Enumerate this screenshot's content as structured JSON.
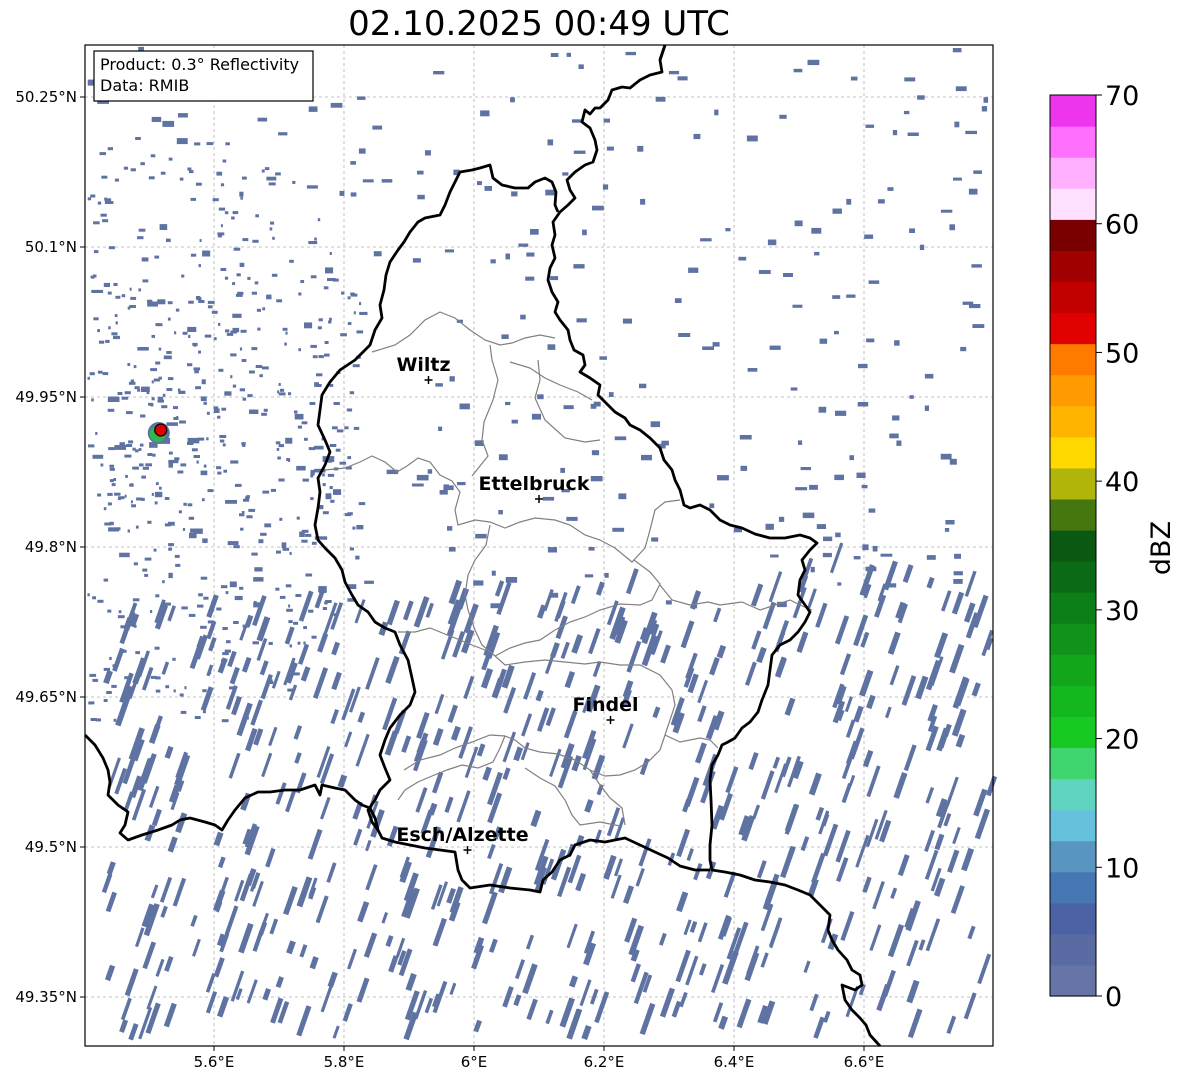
{
  "title": "02.10.2025 00:49 UTC",
  "info": {
    "product": "Product: 0.3° Reflectivity",
    "data": "Data: RMIB"
  },
  "axes": {
    "x_ticks": [
      "5.6°E",
      "5.8°E",
      "6°E",
      "6.2°E",
      "6.4°E",
      "6.6°E"
    ],
    "y_ticks": [
      "50.25°N",
      "50.1°N",
      "49.95°N",
      "49.8°N",
      "49.65°N",
      "49.5°N",
      "49.35°N"
    ],
    "lon_range": [
      5.41,
      6.8
    ],
    "lat_range": [
      49.3,
      50.3
    ],
    "grid": true
  },
  "cities": [
    {
      "name": "Wiltz",
      "lon": 5.93,
      "lat": 49.967
    },
    {
      "name": "Ettelbruck",
      "lon": 6.1,
      "lat": 49.848
    },
    {
      "name": "Findel",
      "lon": 6.21,
      "lat": 49.627
    },
    {
      "name": "Esch/Alzette",
      "lon": 5.99,
      "lat": 49.497
    }
  ],
  "radar_site": {
    "lon": 5.515,
    "lat": 49.914
  },
  "colorbar": {
    "label": "dBZ",
    "min": 0,
    "max": 70,
    "ticks": [
      "0",
      "10",
      "20",
      "30",
      "40",
      "50",
      "60",
      "70"
    ],
    "colors": [
      "#6675a6",
      "#5a6ba3",
      "#4b62a4",
      "#4777b2",
      "#5895c0",
      "#66c2dc",
      "#5fd5c0",
      "#3fd670",
      "#17c922",
      "#13b81e",
      "#12a71a",
      "#11931a",
      "#0d7f19",
      "#0b6a16",
      "#0a5811",
      "#44780f",
      "#b1b509",
      "#ffd800",
      "#ffb400",
      "#ff9a00",
      "#ff7b00",
      "#e00000",
      "#c30000",
      "#a10000",
      "#780000",
      "#ffe0ff",
      "#ffb0ff",
      "#ff70ff",
      "#ee35ee"
    ]
  },
  "echo_color": "#5f73a3"
}
